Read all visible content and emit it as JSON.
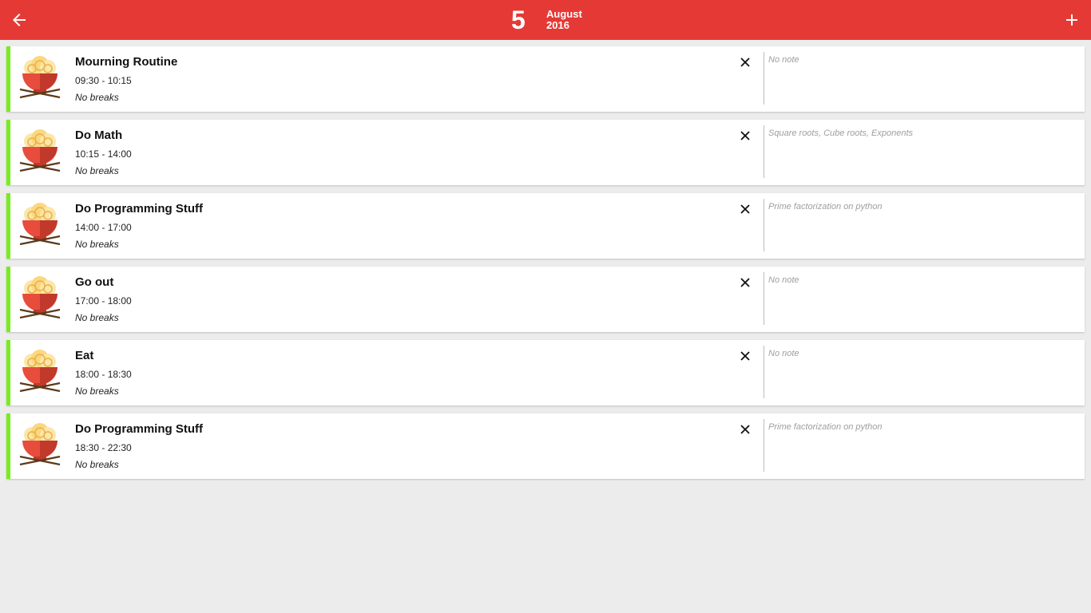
{
  "header": {
    "back_icon": "arrow-left-icon",
    "day": "5",
    "month": "August",
    "year": "2016",
    "add_icon": "plus-icon"
  },
  "colors": {
    "header_bg": "#e53935",
    "accent": "#76ee1b",
    "background": "#ececec"
  },
  "tasks": [
    {
      "title": "Mourning Routine",
      "time": "09:30 - 10:15",
      "breaks": "No breaks",
      "note": "No note",
      "icon": "noodle-bowl-icon"
    },
    {
      "title": "Do Math",
      "time": "10:15 - 14:00",
      "breaks": "No breaks",
      "note": "Square roots, Cube roots, Exponents",
      "icon": "noodle-bowl-icon"
    },
    {
      "title": "Do Programming Stuff",
      "time": "14:00 - 17:00",
      "breaks": "No breaks",
      "note": "Prime factorization on python",
      "icon": "noodle-bowl-icon"
    },
    {
      "title": "Go out",
      "time": "17:00 - 18:00",
      "breaks": "No breaks",
      "note": "No note",
      "icon": "noodle-bowl-icon"
    },
    {
      "title": "Eat",
      "time": "18:00 - 18:30",
      "breaks": "No breaks",
      "note": "No note",
      "icon": "noodle-bowl-icon"
    },
    {
      "title": "Do Programming Stuff",
      "time": "18:30 - 22:30",
      "breaks": "No breaks",
      "note": "Prime factorization on python",
      "icon": "noodle-bowl-icon"
    }
  ]
}
